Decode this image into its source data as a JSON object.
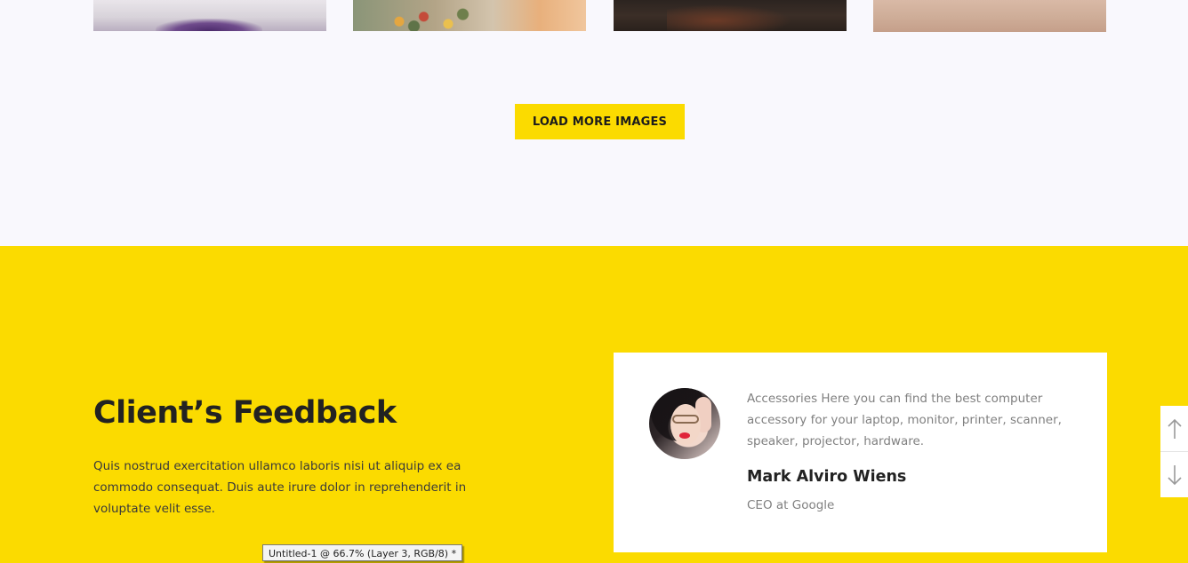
{
  "gallery": {
    "thumbnails": [
      {
        "name": "purple-glitter"
      },
      {
        "name": "flowers"
      },
      {
        "name": "dark-forest"
      },
      {
        "name": "sand"
      }
    ]
  },
  "load_more": {
    "label": "LOAD MORE IMAGES"
  },
  "feedback": {
    "title": "Client’s Feedback",
    "description": "Quis nostrud exercitation ullamco laboris nisi ut aliquip ex ea commodo consequat. Duis aute irure dolor in reprehenderit in voluptate velit esse.",
    "testimonial": {
      "quote": "Accessories Here you can find the best computer accessory for your laptop, monitor, printer, scanner, speaker, projector, hardware.",
      "name": "Mark Alviro Wiens",
      "role": "CEO at Google"
    }
  },
  "scroll_nav": {
    "up_icon": "arrow-up-icon",
    "down_icon": "arrow-down-icon"
  },
  "tooltip": {
    "text": "Untitled-1 @ 66.7% (Layer 3, RGB/8) *"
  },
  "colors": {
    "accent": "#fbdb00",
    "page_bg": "#f9f8fd",
    "heading": "#222222",
    "muted_text": "#808080"
  }
}
